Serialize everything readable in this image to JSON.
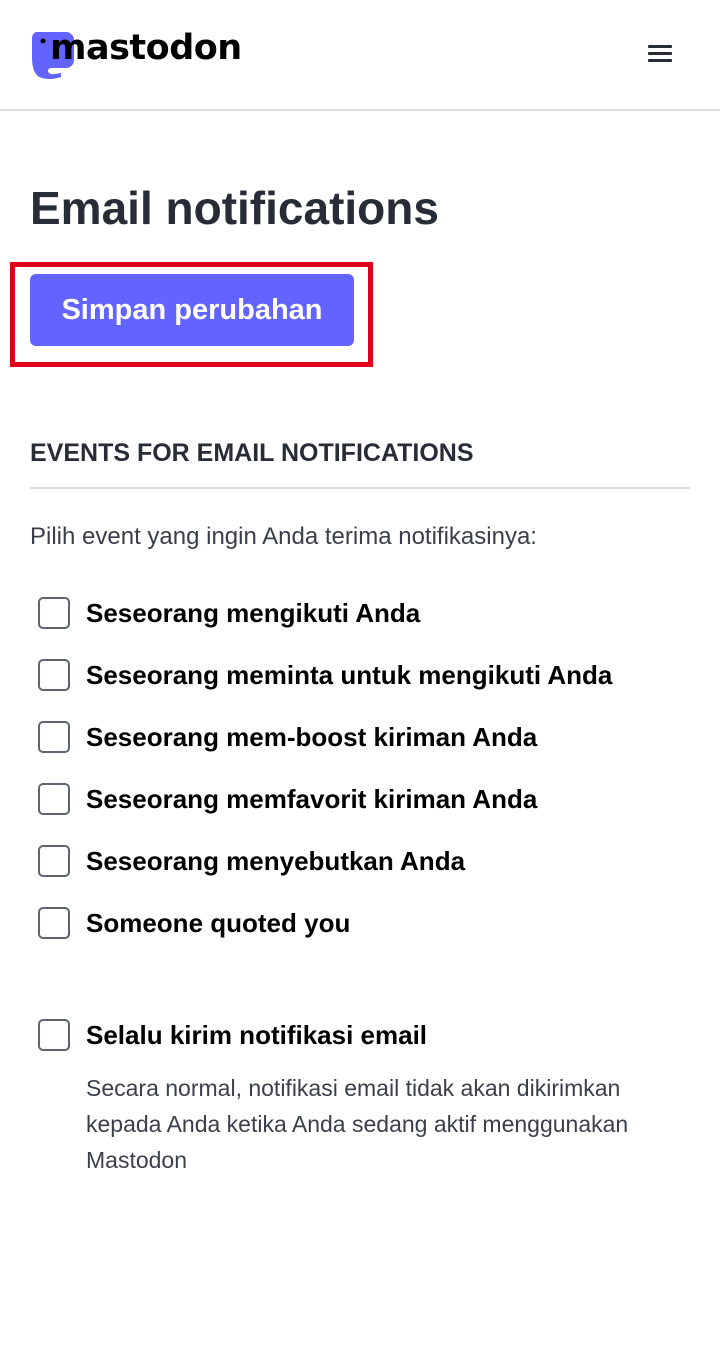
{
  "header": {
    "logo_text": "mastodon",
    "brand_color": "#6364ff",
    "menu_icon": "hamburger-menu-icon"
  },
  "page": {
    "title": "Email notifications"
  },
  "actions": {
    "save_label": "Simpan perubahan",
    "highlight_color": "#e1001c"
  },
  "section": {
    "heading": "EVENTS FOR EMAIL NOTIFICATIONS",
    "intro": "Pilih event yang ingin Anda terima notifikasinya:",
    "options": [
      {
        "label": "Seseorang mengikuti Anda",
        "checked": false
      },
      {
        "label": "Seseorang meminta untuk mengikuti Anda",
        "checked": false
      },
      {
        "label": "Seseorang mem-boost kiriman Anda",
        "checked": false
      },
      {
        "label": "Seseorang memfavorit kiriman Anda",
        "checked": false
      },
      {
        "label": "Seseorang menyebutkan Anda",
        "checked": false
      },
      {
        "label": "Someone quoted you",
        "checked": false
      }
    ]
  },
  "always_send": {
    "label": "Selalu kirim notifikasi email",
    "checked": false,
    "hint": "Secara normal, notifikasi email tidak akan dikirimkan kepada Anda ketika Anda sedang aktif menggunakan Mastodon"
  }
}
